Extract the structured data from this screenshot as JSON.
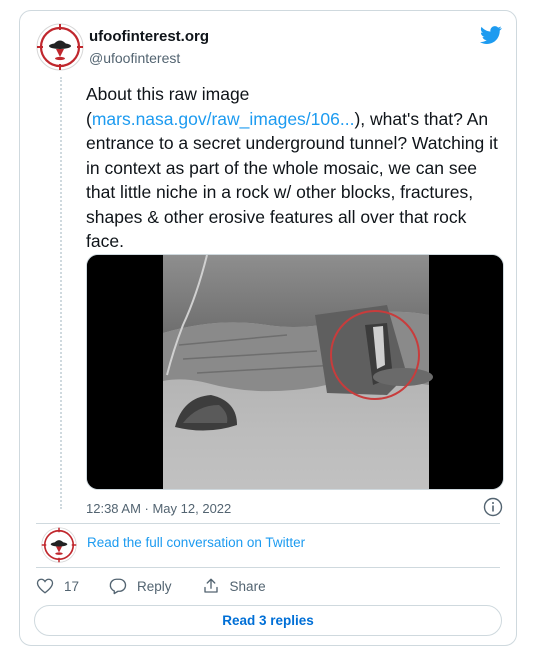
{
  "author": {
    "name": "ufoofinterest.org",
    "handle": "@ufoofinterest"
  },
  "tweet": {
    "text_before": "About this raw image (",
    "link_text": "mars.nasa.gov/raw_images/106...",
    "text_after": "), what's that? An entrance to a secret underground tunnel? Watching it in context as part of the whole mosaic, we can see that little niche in a rock w/ other blocks, fractures, shapes & other erosive features all over that rock face.",
    "timestamp": "12:38 AM · May 12, 2022"
  },
  "conversation": {
    "link_label": "Read the full conversation on Twitter"
  },
  "actions": {
    "like_count": "17",
    "reply_label": "Reply",
    "share_label": "Share"
  },
  "read_replies_label": "Read 3 replies",
  "colors": {
    "twitter_blue": "#1d9bf0",
    "avatar_red": "#c0272d",
    "border": "#cfd9de",
    "muted_text": "#536471"
  }
}
